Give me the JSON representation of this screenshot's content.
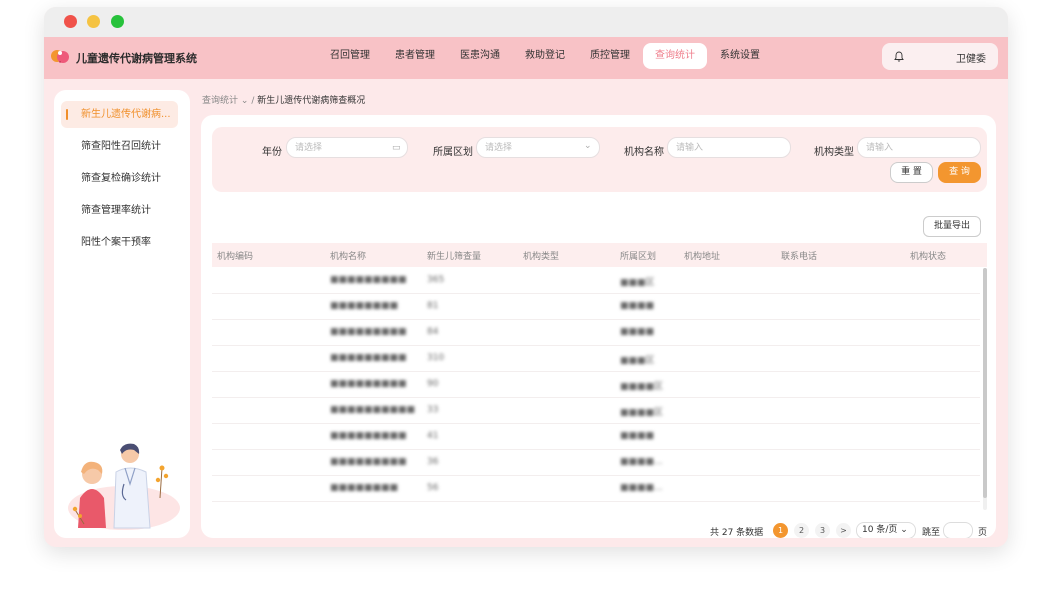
{
  "app": {
    "title": "儿童遗传代谢病管理系统",
    "nav": [
      "召回管理",
      "患者管理",
      "医患沟通",
      "救助登记",
      "质控管理",
      "查询统计",
      "系统设置"
    ],
    "active_nav": "查询统计",
    "user": "卫健委"
  },
  "sidebar": {
    "items": [
      {
        "label": "新生儿遗传代谢病..."
      },
      {
        "label": "筛查阳性召回统计"
      },
      {
        "label": "筛查复检确诊统计"
      },
      {
        "label": "筛查管理率统计"
      },
      {
        "label": "阳性个案干预率"
      }
    ]
  },
  "breadcrumb": {
    "parent": "查询统计",
    "separator": "/",
    "current": "新生儿遗传代谢病筛查概况"
  },
  "filters": {
    "year_label": "年份",
    "year_placeholder": "请选择",
    "district_label": "所属区划",
    "district_placeholder": "请选择",
    "org_name_label": "机构名称",
    "org_name_placeholder": "请输入",
    "org_type_label": "机构类型",
    "org_type_placeholder": "请输入",
    "reset": "重 置",
    "query": "查 询"
  },
  "export_label": "批量导出",
  "table": {
    "columns": [
      "机构编码",
      "机构名称",
      "新生儿筛查量",
      "机构类型",
      "所属区划",
      "机构地址",
      "联系电话",
      "机构状态"
    ],
    "rows": [
      {
        "name": "■■■■■■■■■",
        "count": "365",
        "district": "■■■区"
      },
      {
        "name": "■■■■■■■■",
        "count": "81",
        "district": "■■■■"
      },
      {
        "name": "■■■■■■■■■",
        "count": "84",
        "district": "■■■■"
      },
      {
        "name": "■■■■■■■■■",
        "count": "310",
        "district": "■■■区"
      },
      {
        "name": "■■■■■■■■■",
        "count": "90",
        "district": "■■■■区"
      },
      {
        "name": "■■■■■■■■■■",
        "count": "33",
        "district": "■■■■区"
      },
      {
        "name": "■■■■■■■■■",
        "count": "41",
        "district": "■■■■"
      },
      {
        "name": "■■■■■■■■■",
        "count": "36",
        "district": "■■■■..."
      },
      {
        "name": "■■■■■■■■",
        "count": "56",
        "district": "■■■■..."
      }
    ]
  },
  "pager": {
    "total": "共 27 条数据",
    "pages": [
      "1",
      "2",
      "3"
    ],
    "next": ">",
    "size": "10 条/页",
    "jump_label": "跳至",
    "unit": "页"
  },
  "colors": {
    "accent": "#f3962f",
    "nav_active_text": "#ef7d8b",
    "appbar": "#f8c2c6",
    "background": "#fde9ea"
  }
}
